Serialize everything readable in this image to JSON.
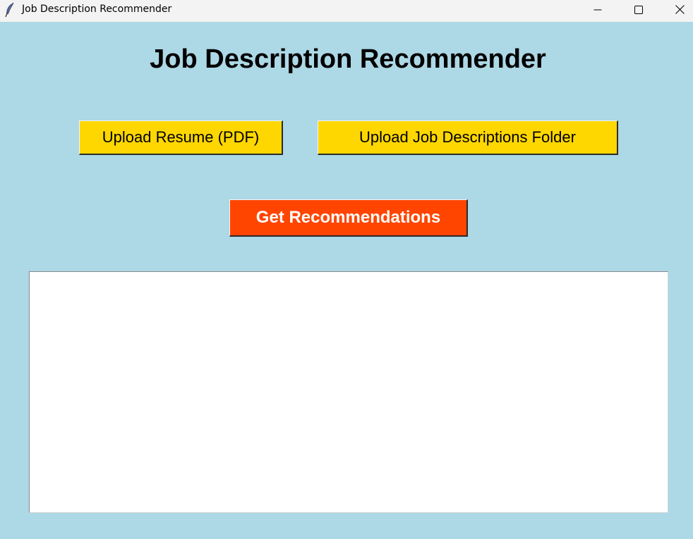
{
  "window": {
    "title": "Job Description Recommender",
    "icon": "feather-icon",
    "controls": {
      "minimize_icon": "minimize-icon",
      "maximize_icon": "maximize-icon",
      "close_icon": "close-icon"
    }
  },
  "main": {
    "heading": "Job Description Recommender",
    "upload_resume_label": "Upload Resume (PDF)",
    "upload_folder_label": "Upload Job Descriptions Folder",
    "recommend_label": "Get Recommendations",
    "results_text": ""
  },
  "colors": {
    "background": "#ADD8E6",
    "upload_button": "#FFD700",
    "recommend_button": "#FF4500",
    "recommend_text": "#FFFFFF",
    "results_background": "#FFFFFF"
  }
}
